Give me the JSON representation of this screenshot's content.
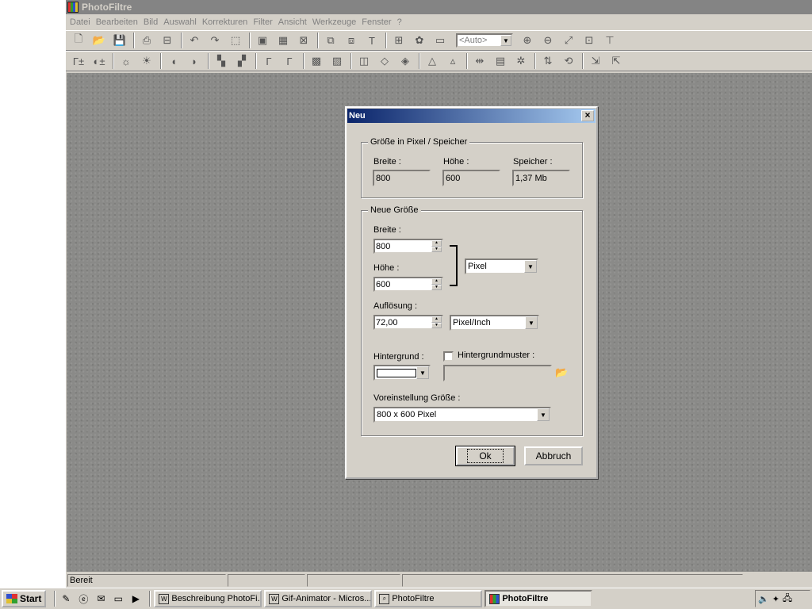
{
  "app": {
    "title": "PhotoFiltre",
    "menu": [
      "Datei",
      "Bearbeiten",
      "Bild",
      "Auswahl",
      "Korrekturen",
      "Filter",
      "Ansicht",
      "Werkzeuge",
      "Fenster",
      "?"
    ],
    "zoom_value": "<Auto>",
    "status": "Bereit"
  },
  "dialog": {
    "title": "Neu",
    "close_glyph": "×",
    "group_size": {
      "legend": "Größe in Pixel / Speicher",
      "width_label": "Breite :",
      "width_value": "800",
      "height_label": "Höhe :",
      "height_value": "600",
      "memory_label": "Speicher :",
      "memory_value": "1,37 Mb"
    },
    "group_new": {
      "legend": "Neue Größe",
      "width_label": "Breite :",
      "width_value": "800",
      "height_label": "Höhe :",
      "height_value": "600",
      "unit_value": "Pixel",
      "resolution_label": "Auflösung :",
      "resolution_value": "72,00",
      "resolution_unit": "Pixel/Inch",
      "background_label": "Hintergrund :",
      "pattern_label": "Hintergrundmuster :",
      "pattern_checked": false,
      "preset_label": "Voreinstellung Größe :",
      "preset_value": "800 x 600 Pixel"
    },
    "ok_label": "Ok",
    "cancel_label": "Abbruch"
  },
  "taskbar": {
    "start_label": "Start",
    "tasks": [
      {
        "label": "Beschreibung PhotoFi...",
        "icon": "word-icon",
        "active": false
      },
      {
        "label": "Gif-Animator - Micros...",
        "icon": "word-icon",
        "active": false
      },
      {
        "label": "PhotoFiltre",
        "icon": "search-window-icon",
        "active": false
      },
      {
        "label": "PhotoFiltre",
        "icon": "photofiltre-icon",
        "active": true
      }
    ]
  }
}
